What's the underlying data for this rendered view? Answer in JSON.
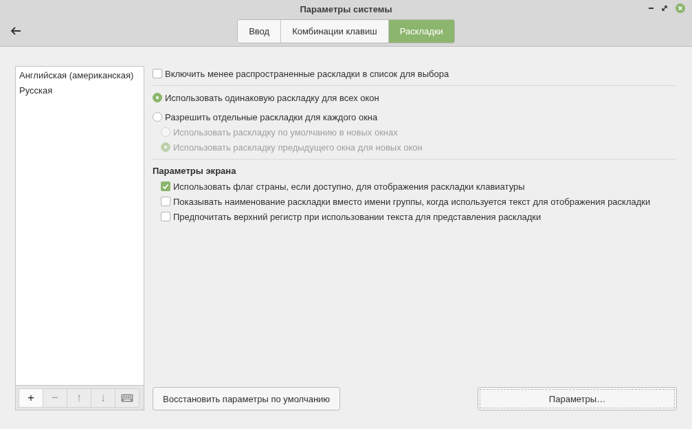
{
  "window": {
    "title": "Параметры системы"
  },
  "tabs": [
    {
      "label": "Ввод",
      "selected": false
    },
    {
      "label": "Комбинации клавиш",
      "selected": false
    },
    {
      "label": "Раскладки",
      "selected": true
    }
  ],
  "layouts": {
    "items": [
      "Английская (американская)",
      "Русская"
    ],
    "toolbar": [
      {
        "kind": "text",
        "label": "+",
        "disabled": false
      },
      {
        "kind": "text",
        "label": "−",
        "disabled": true
      },
      {
        "kind": "text",
        "label": "↑",
        "disabled": true
      },
      {
        "kind": "text",
        "label": "↓",
        "disabled": true
      },
      {
        "kind": "keyboard",
        "disabled": true
      }
    ]
  },
  "rare_layouts": {
    "label": "Включить менее распространенные раскладки в список для выбора",
    "checked": false
  },
  "window_mode": [
    {
      "label": "Использовать одинаковую раскладку для всех окон",
      "selected": true,
      "disabled": false
    },
    {
      "label": "Разрешить отдельные раскладки для каждого окна",
      "selected": false,
      "disabled": false,
      "children": [
        {
          "label": "Использовать раскладку по умолчанию в новых окнах",
          "selected": false,
          "disabled": true
        },
        {
          "label": "Использовать раскладку предыдущего окна для новых окон",
          "selected": true,
          "disabled": true
        }
      ]
    }
  ],
  "display": {
    "title": "Параметры экрана",
    "options": [
      {
        "label": "Использовать флаг страны, если доступно, для отображения раскладки клавиатуры",
        "checked": true
      },
      {
        "label": "Показывать наименование раскладки вместо имени группы, когда используется текст для отображения раскладки",
        "checked": false
      },
      {
        "label": "Предпочитать верхний регистр при использовании текста для представления раскладки",
        "checked": false
      }
    ]
  },
  "buttons": [
    {
      "label": "Восстановить параметры по умолчанию",
      "kind": "reset"
    },
    {
      "label": "Параметры…",
      "kind": "options"
    }
  ]
}
